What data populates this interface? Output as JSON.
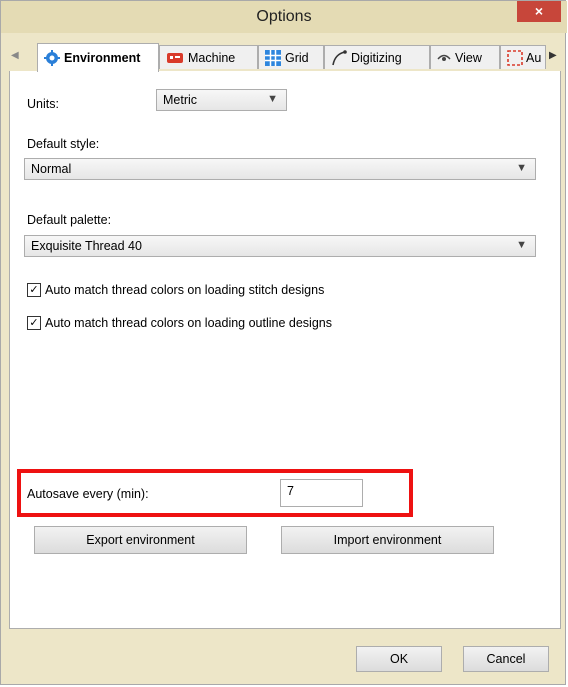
{
  "window": {
    "title": "Options",
    "close_glyph": "×"
  },
  "tabs": [
    {
      "label": "Environment",
      "icon": "gear-icon",
      "color": "#2a7fd8"
    },
    {
      "label": "Machine",
      "icon": "machine-icon",
      "color": "#d93a2a"
    },
    {
      "label": "Grid",
      "icon": "grid-icon",
      "color": "#2e86de"
    },
    {
      "label": "Digitizing",
      "icon": "digitize-curve-icon",
      "color": "#333333"
    },
    {
      "label": "View",
      "icon": "eye-icon",
      "color": "#444444"
    },
    {
      "label": "Au",
      "icon": "auto-select-icon",
      "color": "#d93a2a"
    }
  ],
  "environment": {
    "units_label": "Units:",
    "units_value": "Metric",
    "default_style_label": "Default style:",
    "default_style_value": "Normal",
    "default_palette_label": "Default palette:",
    "default_palette_value": "Exquisite Thread 40",
    "auto_match_stitch": {
      "label": "Auto match thread colors on loading stitch designs",
      "checked": true
    },
    "auto_match_outline": {
      "label": "Auto match thread colors on loading outline designs",
      "checked": true
    },
    "autosave_label": "Autosave every (min):",
    "autosave_value": "7",
    "export_button": "Export environment",
    "import_button": "Import environment"
  },
  "footer": {
    "ok_label": "OK",
    "cancel_label": "Cancel"
  },
  "colors": {
    "highlight": "#ee1111",
    "titlebar": "#e4dbb4",
    "close": "#c7463a"
  }
}
